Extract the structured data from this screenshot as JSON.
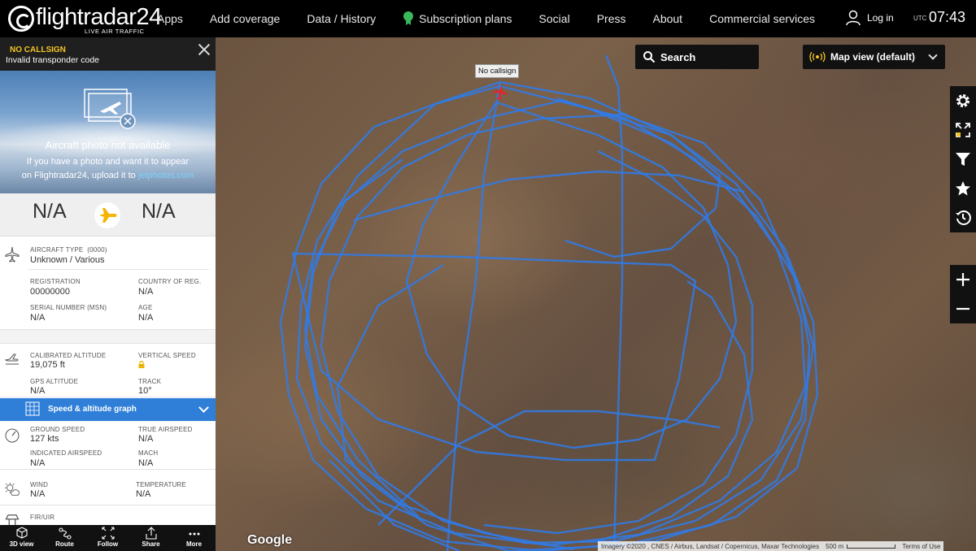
{
  "brand": {
    "name": "flightradar24",
    "tagline": "LIVE AIR TRAFFIC"
  },
  "nav": {
    "items": [
      "Apps",
      "Add coverage",
      "Data / History",
      "Subscription plans",
      "Social",
      "Press",
      "About",
      "Commercial services"
    ],
    "login": "Log in",
    "utc_label": "UTC",
    "time": "07:43"
  },
  "panel": {
    "callsign": "NO CALLSIGN",
    "squawk_note": "Invalid transponder code",
    "photo": {
      "title": "Aircraft photo not available",
      "line1": "If you have a photo and want it to appear",
      "line2": "on Flightradar24, upload it to",
      "link": "jetphotos.com"
    },
    "route": {
      "from": "N/A",
      "to": "N/A"
    },
    "aircraft": {
      "type_label": "AIRCRAFT TYPE",
      "type_code": "(0000)",
      "type_value": "Unknown / Various",
      "registration_label": "REGISTRATION",
      "registration": "00000000",
      "country_label": "COUNTRY OF REG.",
      "country": "N/A",
      "serial_label": "SERIAL NUMBER (MSN)",
      "serial": "N/A",
      "age_label": "AGE",
      "age": "N/A"
    },
    "altitude": {
      "cal_label": "CALIBRATED ALTITUDE",
      "cal_value": "19,075 ft",
      "vs_label": "VERTICAL SPEED",
      "gps_label": "GPS ALTITUDE",
      "gps_value": "N/A",
      "track_label": "TRACK",
      "track_value": "10°"
    },
    "graph_label": "Speed & altitude graph",
    "speed": {
      "gs_label": "GROUND SPEED",
      "gs_value": "127 kts",
      "tas_label": "TRUE AIRSPEED",
      "tas_value": "N/A",
      "ias_label": "INDICATED AIRSPEED",
      "ias_value": "N/A",
      "mach_label": "MACH",
      "mach_value": "N/A"
    },
    "weather": {
      "wind_label": "WIND",
      "wind_value": "N/A",
      "temp_label": "TEMPERATURE",
      "temp_value": "N/A"
    },
    "fir_label": "FIR/UIR",
    "bottom": [
      "3D view",
      "Route",
      "Follow",
      "Share",
      "More"
    ]
  },
  "map": {
    "search_label": "Search",
    "view_label": "Map view (default)",
    "callsign_tag": "No callsign",
    "google": "Google",
    "attribution": "Imagery ©2020 , CNES / Airbus, Landsat / Copernicus, Maxar Technologies",
    "scale": "500 m",
    "terms": "Terms of Use",
    "track_color": "#2f7bea",
    "tools": [
      "gear-icon",
      "expand-icon",
      "filter-icon",
      "star-icon",
      "history-icon",
      "zoom-in-icon",
      "zoom-out-icon"
    ]
  }
}
